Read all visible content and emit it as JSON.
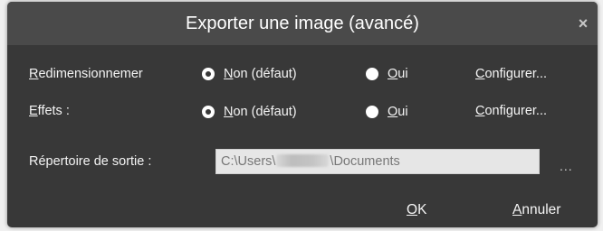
{
  "dialog": {
    "title": "Exporter une image (avancé)",
    "close_glyph": "×"
  },
  "rows": [
    {
      "label_accesskey": "R",
      "label_rest": "edimensionnemer",
      "option_no": {
        "accesskey": "N",
        "rest": "on (défaut)",
        "selected": true
      },
      "option_yes": {
        "accesskey": "O",
        "rest": "ui",
        "selected": false
      },
      "configure": {
        "accesskey": "C",
        "rest": "onfigurer..."
      }
    },
    {
      "label_accesskey": "E",
      "label_rest": "ffets :",
      "option_no": {
        "accesskey": "N",
        "rest": "on (défaut)",
        "selected": true
      },
      "option_yes": {
        "accesskey": "O",
        "rest": "ui",
        "selected": false
      },
      "configure": {
        "accesskey": "C",
        "rest": "onfigurer..."
      }
    }
  ],
  "output": {
    "label": "Répertoire de sortie :",
    "path_prefix": "C:\\Users\\",
    "path_suffix": "\\Documents",
    "browse_label": "..."
  },
  "buttons": {
    "ok_accesskey": "O",
    "ok_rest": "K",
    "cancel_accesskey": "A",
    "cancel_rest": "nnuler"
  },
  "colors": {
    "dialog_bg": "#383838",
    "titlebar_bg": "#4a4a4a",
    "text": "#f4f4f4",
    "field_bg": "#e6e6e6",
    "field_text": "#777777"
  },
  "icons": {
    "close": "close-icon",
    "radio_checked": "radio-checked-icon",
    "radio_unchecked": "radio-unchecked-icon"
  }
}
